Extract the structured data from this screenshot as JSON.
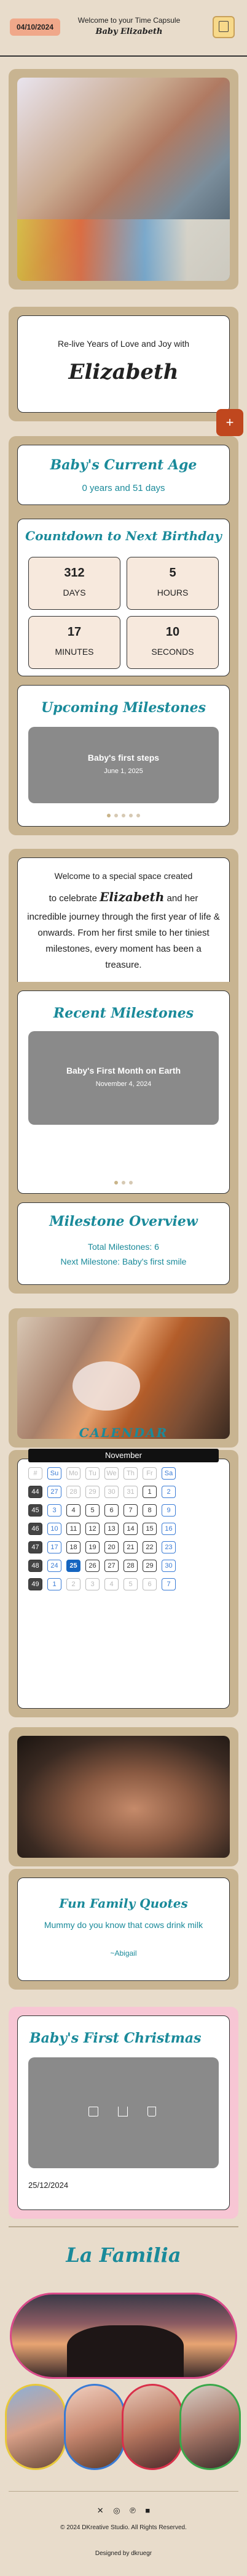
{
  "header": {
    "date_badge": "04/10/2024",
    "welcome": "Welcome to your Time Capsule",
    "name": "Baby Elizabeth"
  },
  "intro": {
    "subtitle": "Re-live Years of Love and Joy with",
    "name": "Elizabeth"
  },
  "fab": {
    "label": "+"
  },
  "age": {
    "title": "Baby's Current Age",
    "value": "0 years and 51 days"
  },
  "countdown": {
    "title": "Countdown to Next Birthday",
    "days": "312",
    "days_label": "DAYS",
    "hours": "5",
    "hours_label": "HOURS",
    "minutes": "17",
    "minutes_label": "MINUTES",
    "seconds": "10",
    "seconds_label": "SECONDS"
  },
  "upcoming": {
    "title": "Upcoming Milestones",
    "item_title": "Baby's first steps",
    "item_date": "June 1, 2025"
  },
  "welcome_text": {
    "line1": "Welcome to a special space created",
    "line2a": "to celebrate",
    "line2name": "Elizabeth",
    "line2b": "and her",
    "rest": "incredible journey through the first year of life & onwards. From her first smile to her tiniest milestones, every moment has been a treasure."
  },
  "recent": {
    "title": "Recent Milestones",
    "item_title": "Baby's First Month on Earth",
    "item_date": "November 4, 2024"
  },
  "overview": {
    "title": "Milestone Overview",
    "total": "Total Milestones: 6",
    "next": "Next Milestone: Baby's first smile"
  },
  "calendar": {
    "title": "CALENDAR",
    "month": "November",
    "days": [
      "Mo",
      "Tu",
      "We",
      "Th",
      "Fr",
      "Sa"
    ],
    "sunday": "Su",
    "blank": "#",
    "rows": [
      {
        "wk": "44",
        "cells": [
          "27",
          "28",
          "29",
          "30",
          "31",
          "1",
          "2"
        ]
      },
      {
        "wk": "45",
        "cells": [
          "3",
          "4",
          "5",
          "6",
          "7",
          "8",
          "9"
        ]
      },
      {
        "wk": "46",
        "cells": [
          "10",
          "11",
          "12",
          "13",
          "14",
          "15",
          "16"
        ]
      },
      {
        "wk": "47",
        "cells": [
          "17",
          "18",
          "19",
          "20",
          "21",
          "22",
          "23"
        ]
      },
      {
        "wk": "48",
        "cells": [
          "24",
          "25",
          "26",
          "27",
          "28",
          "29",
          "30"
        ]
      },
      {
        "wk": "49",
        "cells": [
          "1",
          "2",
          "3",
          "4",
          "5",
          "6",
          "7"
        ]
      }
    ]
  },
  "quotes": {
    "title": "Fun Family Quotes",
    "quote": "Mummy do you know that cows drink milk",
    "author": "~Abigail"
  },
  "christmas": {
    "title": "Baby's First Christmas",
    "date": "25/12/2024"
  },
  "familia": {
    "title": "La Familia"
  },
  "footer": {
    "copyright": "© 2024 DKreative Studio. All Rights Reserved.",
    "designed": "Designed by dkruegr"
  }
}
